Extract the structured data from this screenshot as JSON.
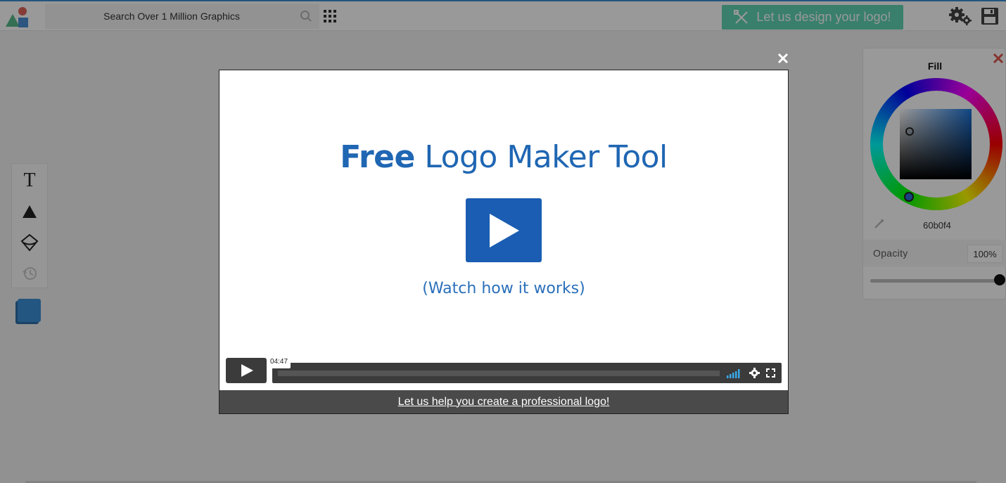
{
  "header": {
    "logo_icon": "shapes-logo-icon",
    "search": {
      "placeholder": "Search Over 1 Million Graphics",
      "value": ""
    },
    "design_button_label": "Let us design your logo!",
    "design_button_color": "#5fd4b4",
    "icons": [
      "search-icon",
      "grid-menu-icon",
      "settings-gears-icon",
      "save-floppy-icon"
    ]
  },
  "toolbar": {
    "tools": [
      {
        "name": "text-tool",
        "glyph": "T"
      },
      {
        "name": "shape-tool",
        "icon": "triangle-icon"
      },
      {
        "name": "layer-tool",
        "icon": "layer-diamond-icon"
      },
      {
        "name": "history-tool",
        "icon": "history-icon"
      }
    ],
    "swatch_color": "#3b8fd6"
  },
  "fill_panel": {
    "title": "Fill",
    "hex": "60b0f4",
    "opacity_label": "Opacity",
    "opacity_value": "100%",
    "opacity_percent": 100
  },
  "modal": {
    "title_bold": "Free",
    "title_rest": " Logo Maker Tool",
    "subtitle": "(Watch how it works)",
    "duration": "04:47",
    "footer_link": "Let us help you create a professional logo!",
    "accent_color": "#1f66b3"
  }
}
